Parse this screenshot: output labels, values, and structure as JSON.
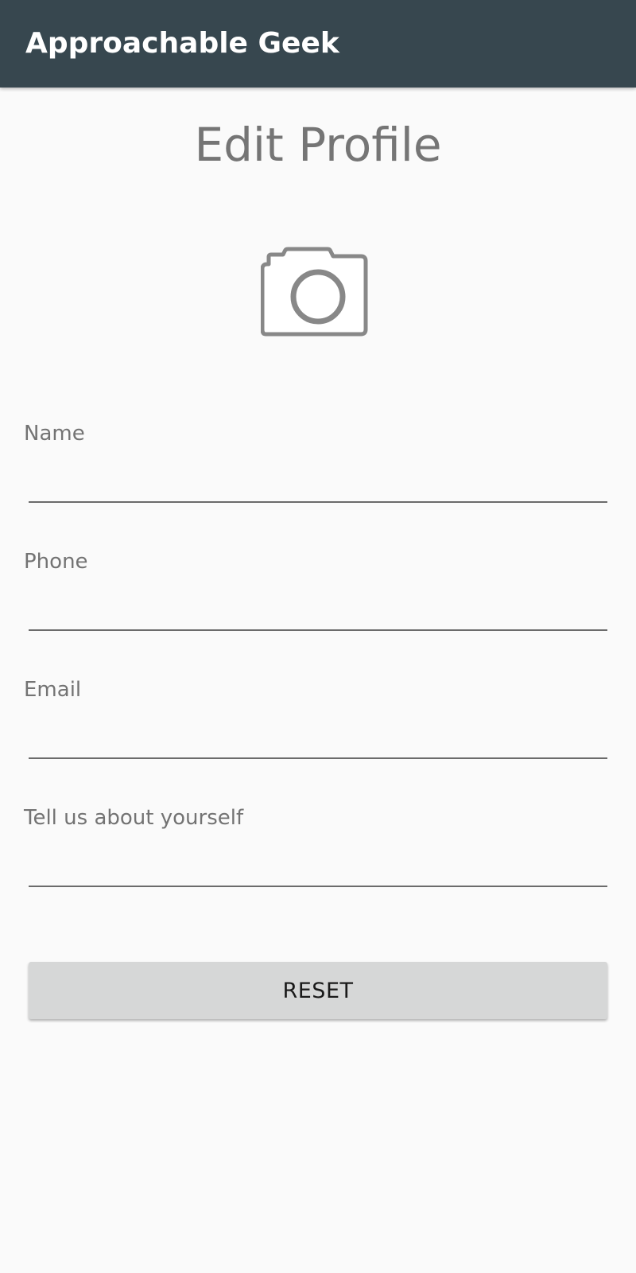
{
  "app_bar": {
    "title": "Approachable Geek"
  },
  "page": {
    "title": "Edit Profile",
    "photo_icon": "camera-icon"
  },
  "form": {
    "fields": [
      {
        "label": "Name",
        "value": ""
      },
      {
        "label": "Phone",
        "value": ""
      },
      {
        "label": "Email",
        "value": ""
      },
      {
        "label": "Tell us about yourself",
        "value": ""
      }
    ],
    "reset_label": "RESET"
  },
  "colors": {
    "app_bar": "#37474f",
    "background": "#fafafa",
    "title_text": "#757575",
    "button_bg": "#d6d7d7"
  }
}
